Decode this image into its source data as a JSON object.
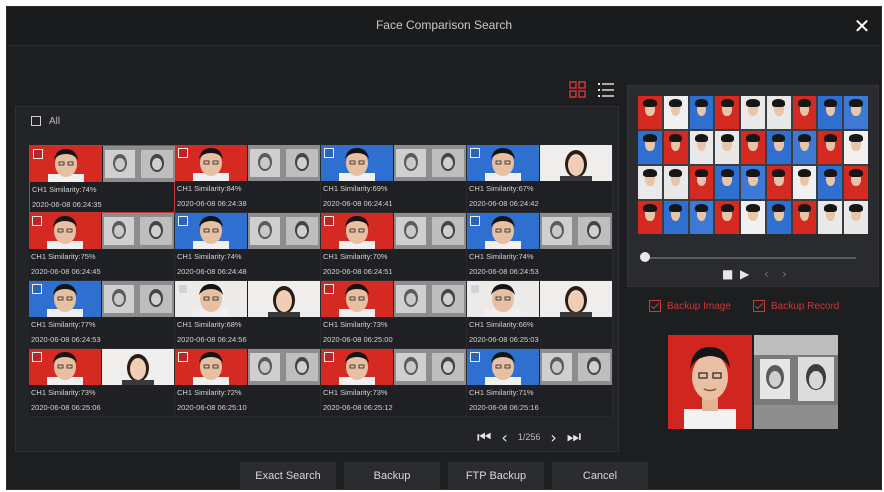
{
  "window": {
    "title": "Face Comparison Search",
    "close_icon": "close-icon"
  },
  "toolbar": {
    "grid_view_icon": "grid-view-icon",
    "list_view_icon": "list-view-icon"
  },
  "results": {
    "select_all_label": "All",
    "items": [
      {
        "line1": "CH1  Similarity:74%",
        "line2": "2020-06-08 06:24:35",
        "snap": "red",
        "ref": "gray"
      },
      {
        "line1": "CH1  Similarity:84%",
        "line2": "2020-06-08 06:24:38",
        "snap": "red",
        "ref": "gray"
      },
      {
        "line1": "CH1  Similarity:69%",
        "line2": "2020-06-08 06:24:41",
        "snap": "blue",
        "ref": "gray"
      },
      {
        "line1": "CH1  Similarity:67%",
        "line2": "2020-06-08 06:24:42",
        "snap": "blue",
        "ref": "white"
      },
      {
        "line1": "CH1  Similarity:75%",
        "line2": "2020-06-08 06:24:45",
        "snap": "red",
        "ref": "gray"
      },
      {
        "line1": "CH1  Similarity:74%",
        "line2": "2020-06-08 06:24:48",
        "snap": "blue",
        "ref": "gray"
      },
      {
        "line1": "CH1  Similarity:70%",
        "line2": "2020-06-08 06:24:51",
        "snap": "red",
        "ref": "gray"
      },
      {
        "line1": "CH1  Similarity:74%",
        "line2": "2020-06-08 06:24:53",
        "snap": "blue",
        "ref": "gray"
      },
      {
        "line1": "CH1  Similarity:77%",
        "line2": "2020-06-08 06:24:53",
        "snap": "blue",
        "ref": "gray"
      },
      {
        "line1": "CH1  Similarity:68%",
        "line2": "2020-06-08 06:24:56",
        "snap": "white",
        "ref": "white"
      },
      {
        "line1": "CH1  Similarity:73%",
        "line2": "2020-06-08 06:25:00",
        "snap": "red",
        "ref": "gray"
      },
      {
        "line1": "CH1  Similarity:66%",
        "line2": "2020-06-08 06:25:03",
        "snap": "white",
        "ref": "white"
      },
      {
        "line1": "CH1  Similarity:73%",
        "line2": "2020-06-08 06:25:06",
        "snap": "red",
        "ref": "white"
      },
      {
        "line1": "CH1  Similarity:72%",
        "line2": "2020-06-08 06:25:10",
        "snap": "red",
        "ref": "gray"
      },
      {
        "line1": "CH1  Similarity:73%",
        "line2": "2020-06-08 06:25:12",
        "snap": "red",
        "ref": "gray"
      },
      {
        "line1": "CH1  Similarity:71%",
        "line2": "2020-06-08 06:25:16",
        "snap": "blue",
        "ref": "gray"
      }
    ]
  },
  "pagination": {
    "page": "1/256"
  },
  "options": {
    "backup_image": "Backup Image",
    "backup_record": "Backup Record"
  },
  "buttons": {
    "exact_search": "Exact Search",
    "backup": "Backup",
    "ftp_backup": "FTP Backup",
    "cancel": "Cancel"
  },
  "colors": {
    "accent": "#c73a3a",
    "background": "#1d1e20",
    "button": "#2b2c30"
  }
}
